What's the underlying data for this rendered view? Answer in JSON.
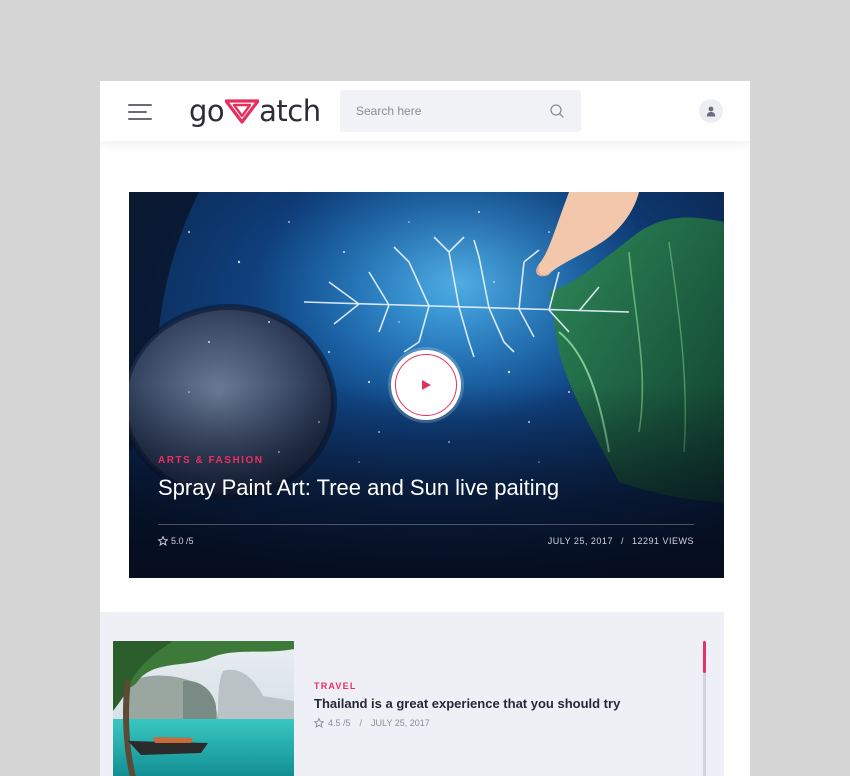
{
  "brand": {
    "name_left": "go",
    "name_right": "atch",
    "accent": "#e8305f"
  },
  "search": {
    "placeholder": "Search here",
    "icon": "search-icon"
  },
  "header": {
    "menu_icon": "hamburger-menu-icon",
    "user_icon": "user-icon"
  },
  "hero": {
    "category": "ARTS & FASHION",
    "title": "Spray Paint Art: Tree and Sun live paiting",
    "rating": "5.0 /5",
    "date": "JULY 25, 2017",
    "separator": "/",
    "views": "12291 VIEWS",
    "play_icon": "play-icon"
  },
  "list": {
    "items": [
      {
        "category": "TRAVEL",
        "title": "Thailand is a great experience that you should try",
        "rating": "4.5 /5",
        "separator": "/",
        "date": "JULY 25, 2017"
      }
    ]
  }
}
